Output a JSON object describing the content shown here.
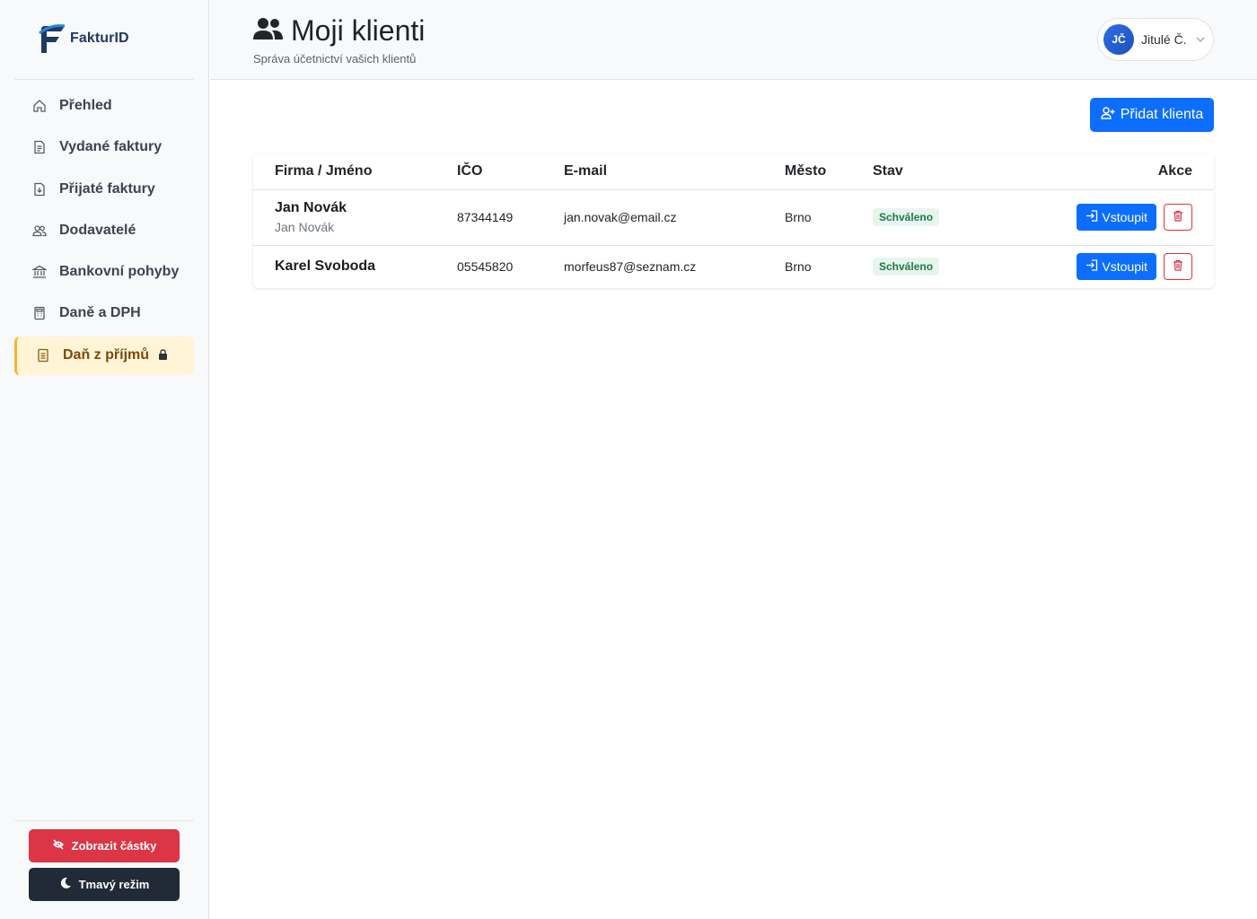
{
  "app": {
    "name": "FakturID"
  },
  "sidebar": {
    "items": [
      {
        "label": "Přehled",
        "icon": "home-icon"
      },
      {
        "label": "Vydané faktury",
        "icon": "file-icon"
      },
      {
        "label": "Přijaté faktury",
        "icon": "file-download-icon"
      },
      {
        "label": "Dodavatelé",
        "icon": "people-icon"
      },
      {
        "label": "Bankovní pohyby",
        "icon": "bank-icon"
      },
      {
        "label": "Daně a DPH",
        "icon": "calculator-icon"
      },
      {
        "label": "Daň z příjmů",
        "icon": "document-icon",
        "locked": true
      }
    ],
    "show_amounts_label": "Zobrazit částky",
    "dark_mode_label": "Tmavý režim"
  },
  "header": {
    "title": "Moji klienti",
    "subtitle": "Správa účetnictví vašich klientů",
    "user": {
      "initials": "JČ",
      "name": "Jitulé Č."
    }
  },
  "main": {
    "add_client_label": "Přidat klienta",
    "table": {
      "columns": [
        "Firma / Jméno",
        "IČO",
        "E-mail",
        "Město",
        "Stav",
        "Akce"
      ],
      "rows": [
        {
          "name": "Jan Novák",
          "subname": "Jan Novák",
          "ico": "87344149",
          "email": "jan.novak@email.cz",
          "city": "Brno",
          "status": "Schváleno",
          "enter_label": "Vstoupit"
        },
        {
          "name": "Karel Svoboda",
          "subname": "",
          "ico": "05545820",
          "email": "morfeus87@seznam.cz",
          "city": "Brno",
          "status": "Schváleno",
          "enter_label": "Vstoupit"
        }
      ]
    }
  },
  "colors": {
    "accent": "#0d6efd",
    "danger": "#dc3545",
    "dark": "#212a37",
    "active_bg": "#fff4d6",
    "active_border": "#f2b632",
    "success_bg": "#e8f5ec",
    "success_text": "#1d7a45"
  }
}
